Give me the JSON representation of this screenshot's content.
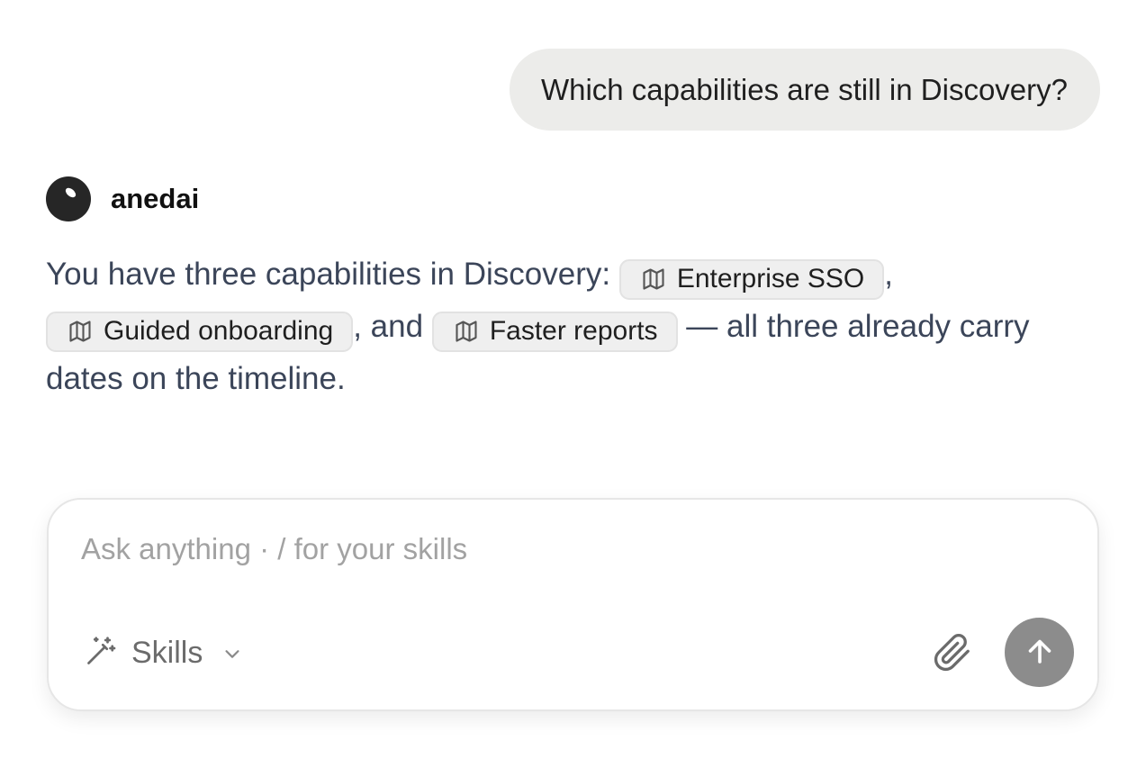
{
  "user_message": {
    "text": "Which capabilities are still in Discovery?"
  },
  "assistant": {
    "name": "anedai",
    "message": {
      "intro": "You have three capabilities in Discovery: ",
      "chips": [
        {
          "label": "Enterprise SSO",
          "icon": "map-icon"
        },
        {
          "label": "Guided onboarding",
          "icon": "map-icon"
        },
        {
          "label": "Faster reports",
          "icon": "map-icon"
        }
      ],
      "sep_1": ",",
      "sep_2": ", and",
      "outro": " — all three already carry dates on the timeline."
    }
  },
  "composer": {
    "placeholder": "Ask anything · / for your skills",
    "skills_label": "Skills",
    "skills_icon": "magic-wand-icon",
    "attach_icon": "paperclip-icon",
    "send_icon": "arrow-up-icon"
  },
  "colors": {
    "user_bubble_bg": "#ececea",
    "assistant_text": "#3b4559",
    "send_button_bg": "#8c8c8c",
    "chip_bg": "#efefef"
  }
}
